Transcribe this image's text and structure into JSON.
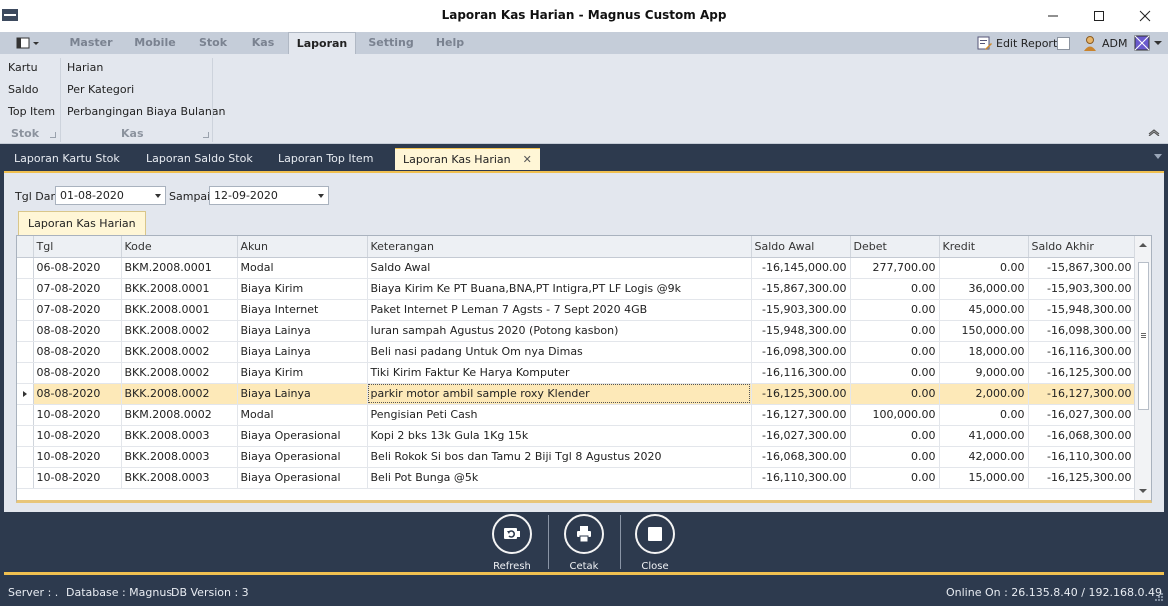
{
  "window": {
    "title": "Laporan Kas Harian - Magnus Custom App"
  },
  "ribbon": {
    "tabs": [
      "Master",
      "Mobile",
      "Stok",
      "Kas",
      "Laporan",
      "Setting",
      "Help"
    ],
    "active_tab": "Laporan",
    "right": {
      "edit_report": "Edit Report",
      "user": "ADM"
    },
    "groups": [
      {
        "name": "Stok",
        "items": [
          "Kartu",
          "Saldo",
          "Top Item"
        ]
      },
      {
        "name": "Kas",
        "items": [
          "Harian",
          "Per Kategori",
          "Perbangingan Biaya Bulanan"
        ]
      }
    ]
  },
  "doc_tabs": [
    "Laporan Kartu Stok",
    "Laporan Saldo Stok",
    "Laporan Top Item",
    "Laporan Kas Harian"
  ],
  "active_doc_tab": "Laporan Kas Harian",
  "filter": {
    "from_label": "Tgl Dari",
    "from_value": "01-08-2020",
    "to_label": "Sampai",
    "to_value": "12-09-2020"
  },
  "inner_tab": "Laporan Kas Harian",
  "grid": {
    "columns": [
      "Tgl",
      "Kode",
      "Akun",
      "Keterangan",
      "Saldo Awal",
      "Debet",
      "Kredit",
      "Saldo Akhir"
    ],
    "rows": [
      [
        "06-08-2020",
        "BKM.2008.0001",
        "Modal",
        "Saldo Awal",
        "-16,145,000.00",
        "277,700.00",
        "0.00",
        "-15,867,300.00"
      ],
      [
        "07-08-2020",
        "BKK.2008.0001",
        "Biaya Kirim",
        "Biaya Kirim Ke PT Buana,BNA,PT Intigra,PT LF Logis @9k",
        "-15,867,300.00",
        "0.00",
        "36,000.00",
        "-15,903,300.00"
      ],
      [
        "07-08-2020",
        "BKK.2008.0001",
        "Biaya Internet",
        "Paket Internet P Leman 7 Agsts - 7 Sept 2020 4GB",
        "-15,903,300.00",
        "0.00",
        "45,000.00",
        "-15,948,300.00"
      ],
      [
        "08-08-2020",
        "BKK.2008.0002",
        "Biaya Lainya",
        "Iuran sampah Agustus 2020 (Potong kasbon)",
        "-15,948,300.00",
        "0.00",
        "150,000.00",
        "-16,098,300.00"
      ],
      [
        "08-08-2020",
        "BKK.2008.0002",
        "Biaya Lainya",
        "Beli nasi padang Untuk Om nya Dimas",
        "-16,098,300.00",
        "0.00",
        "18,000.00",
        "-16,116,300.00"
      ],
      [
        "08-08-2020",
        "BKK.2008.0002",
        "Biaya Kirim",
        "Tiki Kirim Faktur Ke Harya Komputer",
        "-16,116,300.00",
        "0.00",
        "9,000.00",
        "-16,125,300.00"
      ],
      [
        "08-08-2020",
        "BKK.2008.0002",
        "Biaya Lainya",
        "parkir motor ambil sample roxy  Klender",
        "-16,125,300.00",
        "0.00",
        "2,000.00",
        "-16,127,300.00"
      ],
      [
        "10-08-2020",
        "BKM.2008.0002",
        "Modal",
        "Pengisian Peti Cash",
        "-16,127,300.00",
        "100,000.00",
        "0.00",
        "-16,027,300.00"
      ],
      [
        "10-08-2020",
        "BKK.2008.0003",
        "Biaya Operasional",
        "Kopi 2 bks 13k Gula 1Kg 15k",
        "-16,027,300.00",
        "0.00",
        "41,000.00",
        "-16,068,300.00"
      ],
      [
        "10-08-2020",
        "BKK.2008.0003",
        "Biaya Operasional",
        "Beli Rokok Si bos dan Tamu 2 Biji Tgl 8 Agustus 2020",
        "-16,068,300.00",
        "0.00",
        "42,000.00",
        "-16,110,300.00"
      ],
      [
        "10-08-2020",
        "BKK.2008.0003",
        "Biaya Operasional",
        "Beli Pot Bunga @5k",
        "-16,110,300.00",
        "0.00",
        "15,000.00",
        "-16,125,300.00"
      ]
    ],
    "selected_row": 6
  },
  "actions": [
    "Refresh",
    "Cetak",
    "Close"
  ],
  "status": {
    "server": "Server : .",
    "database": "Database : Magnus",
    "db_version": "DB Version : 3",
    "online": "Online On : 26.135.8.40 / 192.168.0.49"
  },
  "colors": {
    "accent": "#f0c050",
    "dark_bg": "#2d3a4e",
    "ribbon_bg": "#e3e7ee",
    "selected_row": "#fde9b8"
  }
}
